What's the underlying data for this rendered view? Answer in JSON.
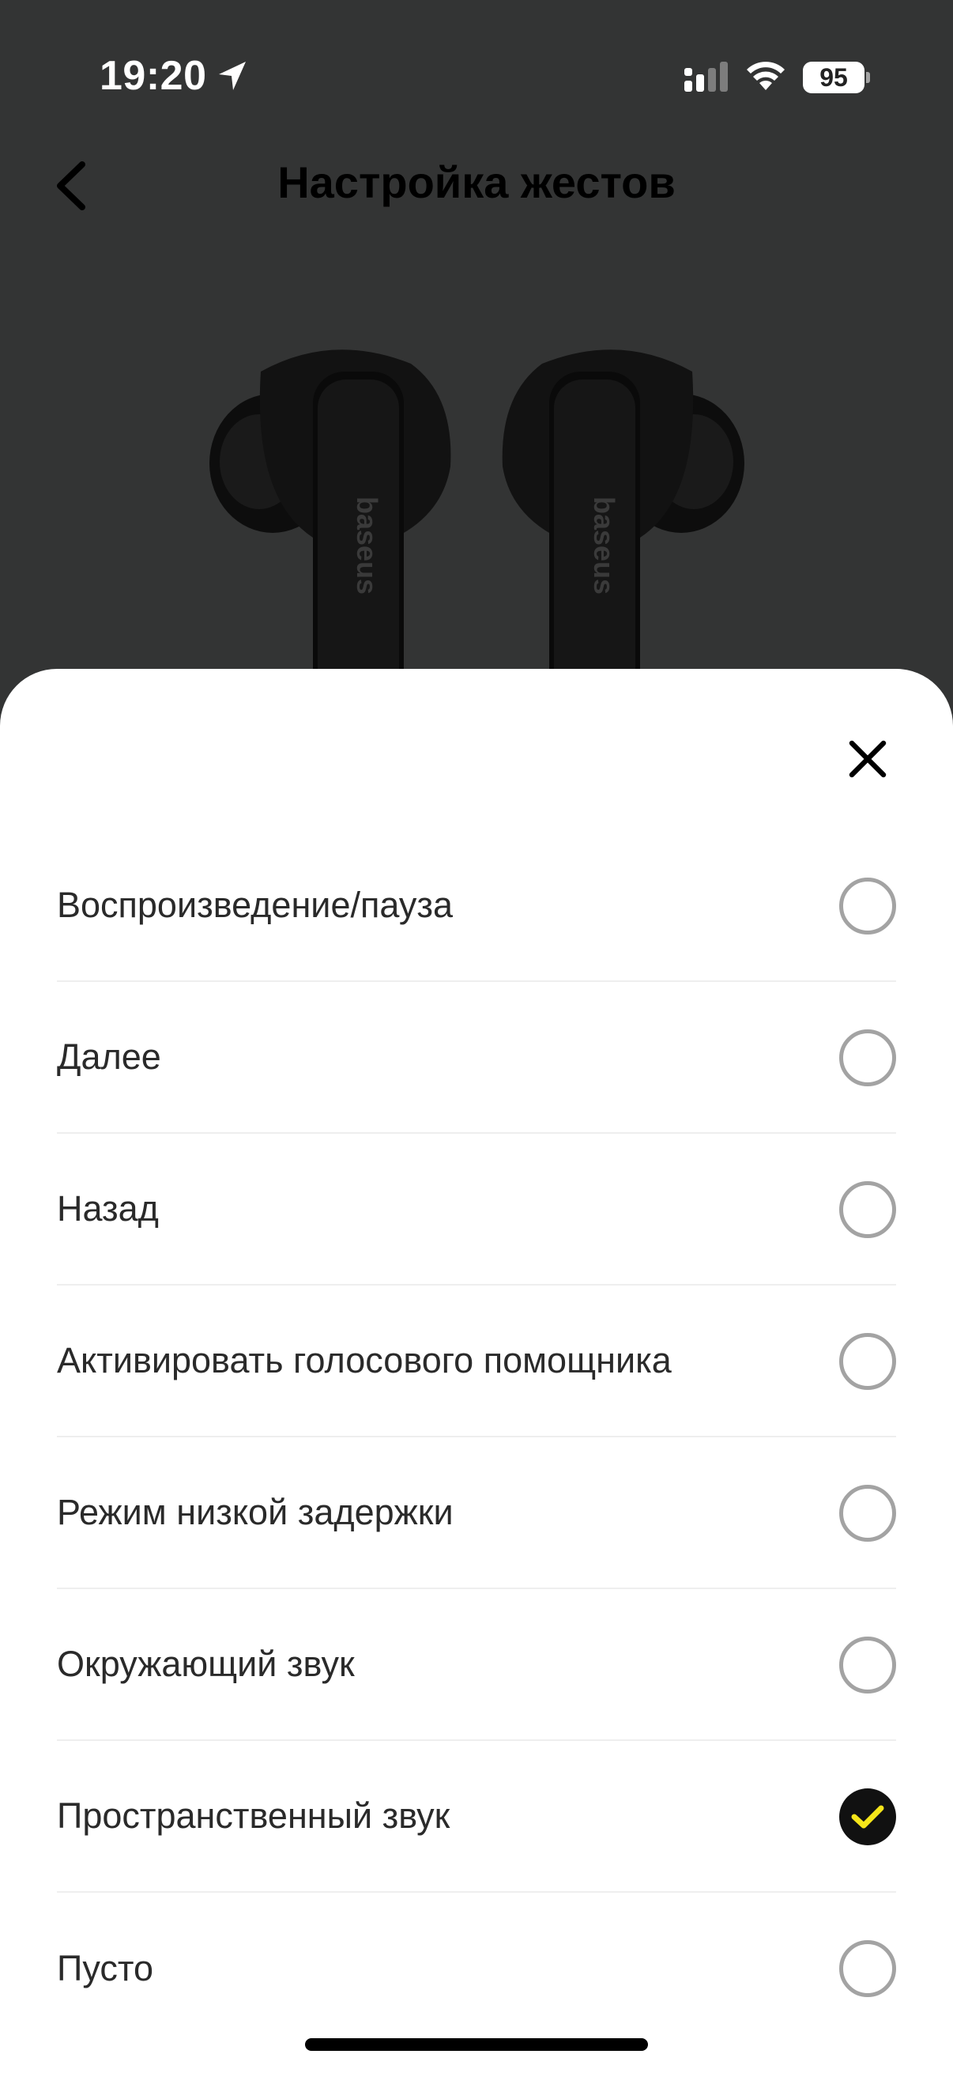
{
  "status_bar": {
    "time": "19:20",
    "battery": "95"
  },
  "header": {
    "title": "Настройка жестов"
  },
  "device_image": {
    "brand_text": "baseus"
  },
  "sheet": {
    "options": [
      {
        "label": "Воспроизведение/пауза",
        "selected": false
      },
      {
        "label": "Далее",
        "selected": false
      },
      {
        "label": "Назад",
        "selected": false
      },
      {
        "label": "Активировать голосового помощника",
        "selected": false
      },
      {
        "label": "Режим низкой задержки",
        "selected": false
      },
      {
        "label": "Окружающий звук",
        "selected": false
      },
      {
        "label": "Пространственный звук",
        "selected": true
      },
      {
        "label": "Пусто",
        "selected": false
      }
    ]
  },
  "colors": {
    "backdrop": "#333434",
    "sheet": "#ffffff",
    "check_accent": "#f5e51a",
    "radio_border": "#a3a3a3"
  }
}
